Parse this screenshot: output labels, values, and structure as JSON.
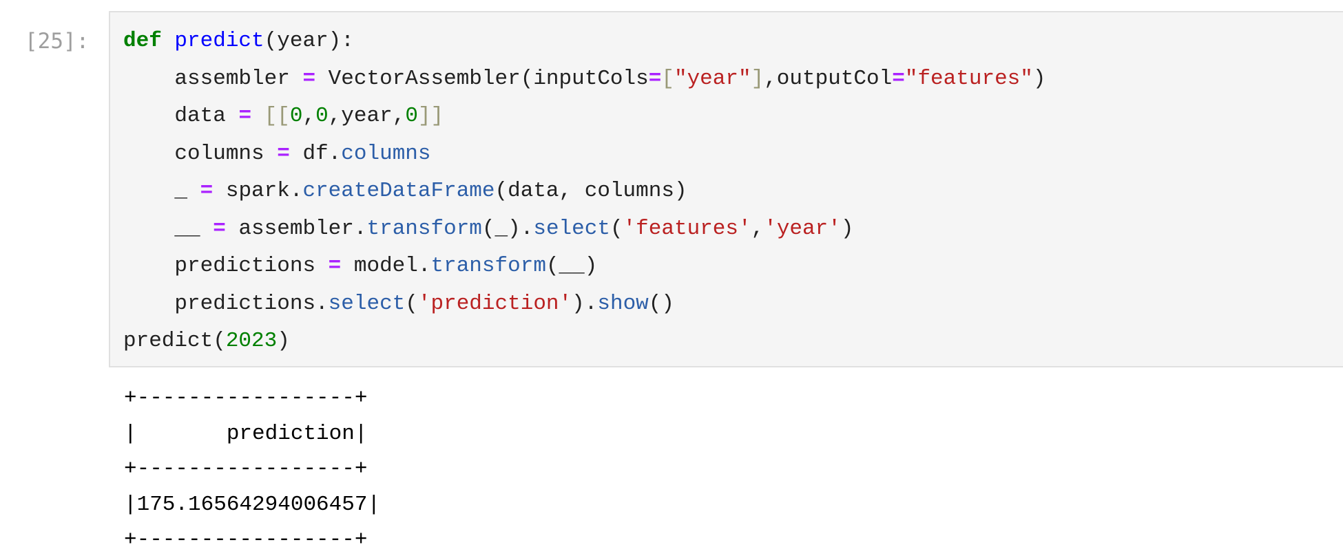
{
  "cell": {
    "prompt": "[25]:",
    "code_lines": [
      [
        [
          "kw",
          "def"
        ],
        [
          "t",
          " "
        ],
        [
          "fn",
          "predict"
        ],
        [
          "t",
          "(year):"
        ]
      ],
      [
        [
          "t",
          "    assembler "
        ],
        [
          "op",
          "="
        ],
        [
          "t",
          " VectorAssembler(inputCols"
        ],
        [
          "op",
          "="
        ],
        [
          "brk",
          "["
        ],
        [
          "str",
          "\"year\""
        ],
        [
          "brk",
          "]"
        ],
        [
          "t",
          ",outputCol"
        ],
        [
          "op",
          "="
        ],
        [
          "str",
          "\"features\""
        ],
        [
          "t",
          ")"
        ]
      ],
      [
        [
          "t",
          "    data "
        ],
        [
          "op",
          "="
        ],
        [
          "t",
          " "
        ],
        [
          "brk",
          "[["
        ],
        [
          "num",
          "0"
        ],
        [
          "t",
          ","
        ],
        [
          "num",
          "0"
        ],
        [
          "t",
          ",year,"
        ],
        [
          "num",
          "0"
        ],
        [
          "brk",
          "]]"
        ]
      ],
      [
        [
          "t",
          "    columns "
        ],
        [
          "op",
          "="
        ],
        [
          "t",
          " df."
        ],
        [
          "attr",
          "columns"
        ]
      ],
      [
        [
          "t",
          "    _ "
        ],
        [
          "op",
          "="
        ],
        [
          "t",
          " spark."
        ],
        [
          "attr",
          "createDataFrame"
        ],
        [
          "t",
          "(data, columns)"
        ]
      ],
      [
        [
          "t",
          "    __ "
        ],
        [
          "op",
          "="
        ],
        [
          "t",
          " assembler."
        ],
        [
          "attr",
          "transform"
        ],
        [
          "t",
          "(_)."
        ],
        [
          "attr",
          "select"
        ],
        [
          "t",
          "("
        ],
        [
          "str",
          "'features'"
        ],
        [
          "t",
          ","
        ],
        [
          "str",
          "'year'"
        ],
        [
          "t",
          ")"
        ]
      ],
      [
        [
          "t",
          "    predictions "
        ],
        [
          "op",
          "="
        ],
        [
          "t",
          " model."
        ],
        [
          "attr",
          "transform"
        ],
        [
          "t",
          "(__)"
        ]
      ],
      [
        [
          "t",
          "    predictions."
        ],
        [
          "attr",
          "select"
        ],
        [
          "t",
          "("
        ],
        [
          "str",
          "'prediction'"
        ],
        [
          "t",
          ")."
        ],
        [
          "attr",
          "show"
        ],
        [
          "t",
          "()"
        ]
      ],
      [
        [
          "t",
          "predict("
        ],
        [
          "num",
          "2023"
        ],
        [
          "t",
          ")"
        ]
      ]
    ],
    "output_lines": [
      "+-----------------+",
      "|       prediction|",
      "+-----------------+",
      "|175.16564294006457|",
      "+-----------------+"
    ]
  },
  "colors": {
    "keyword": "#008000",
    "function_name": "#0000ff",
    "operator": "#aa22ff",
    "string": "#ba2121",
    "number": "#008000",
    "attribute": "#2c5ea8",
    "bracket": "#999977",
    "prompt": "#9e9e9e",
    "cell_background": "#f5f5f5"
  }
}
